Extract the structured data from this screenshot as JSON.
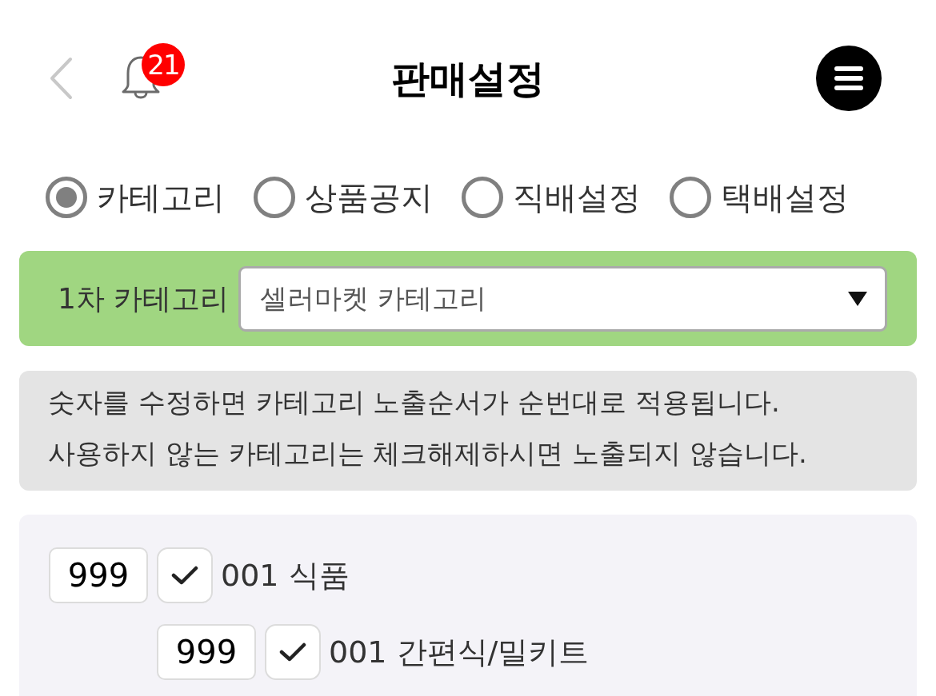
{
  "header": {
    "title": "판매설정",
    "notification_count": "21"
  },
  "tabs": [
    {
      "label": "카테고리",
      "selected": true
    },
    {
      "label": "상품공지",
      "selected": false
    },
    {
      "label": "직배설정",
      "selected": false
    },
    {
      "label": "택배설정",
      "selected": false
    }
  ],
  "category_filter": {
    "label": "1차 카테고리",
    "value": "셀러마켓 카테고리"
  },
  "notice": {
    "lines": [
      "숫자를 수정하면 카테고리 노출순서가 순번대로 적용됩니다.",
      "사용하지 않는 카테고리는 체크해제하시면 노출되지 않습니다."
    ]
  },
  "categories": [
    {
      "order": "999",
      "checked": true,
      "label": "001 식품",
      "children": [
        {
          "order": "999",
          "checked": true,
          "label": "001 간편식/밀키트"
        }
      ]
    }
  ]
}
